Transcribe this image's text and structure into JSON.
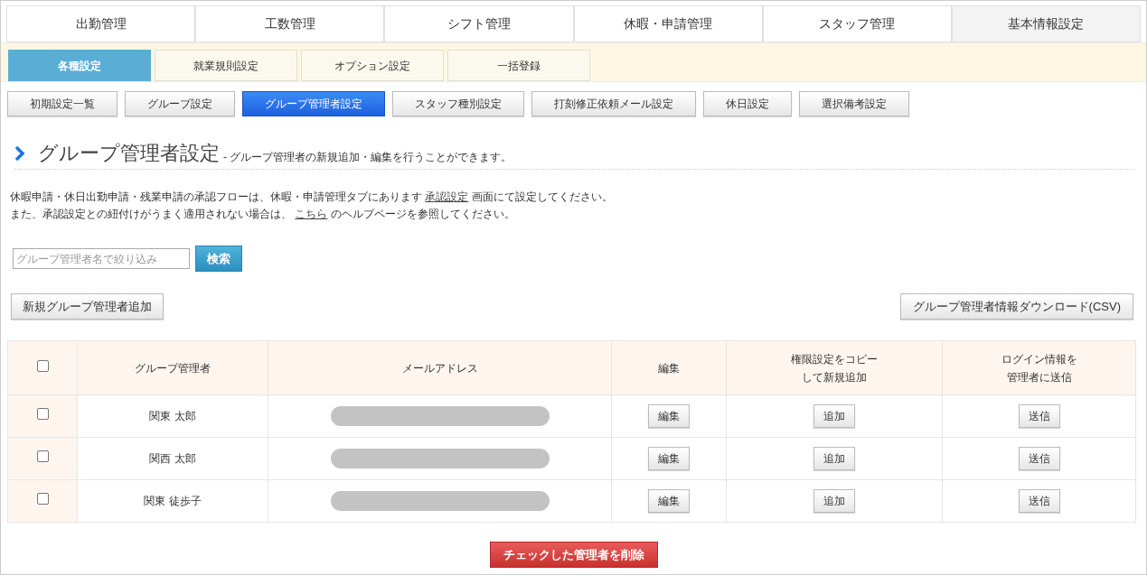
{
  "main_tabs": [
    {
      "label": "出勤管理",
      "selected": false
    },
    {
      "label": "工数管理",
      "selected": false
    },
    {
      "label": "シフト管理",
      "selected": false
    },
    {
      "label": "休暇・申請管理",
      "selected": false
    },
    {
      "label": "スタッフ管理",
      "selected": false
    },
    {
      "label": "基本情報設定",
      "selected": true
    }
  ],
  "sub_tabs": [
    {
      "label": "各種設定",
      "selected": true
    },
    {
      "label": "就業規則設定",
      "selected": false
    },
    {
      "label": "オプション設定",
      "selected": false
    },
    {
      "label": "一括登録",
      "selected": false
    }
  ],
  "setting_buttons": [
    {
      "label": "初期設定一覧",
      "selected": false
    },
    {
      "label": "グループ設定",
      "selected": false
    },
    {
      "label": "グループ管理者設定",
      "selected": true
    },
    {
      "label": "スタッフ種別設定",
      "selected": false
    },
    {
      "label": "打刻修正依頼メール設定",
      "selected": false
    },
    {
      "label": "休日設定",
      "selected": false
    },
    {
      "label": "選択備考設定",
      "selected": false
    }
  ],
  "page_title": "グループ管理者設定",
  "page_subtitle": "- グループ管理者の新規追加・編集を行うことができます。",
  "notes": [
    {
      "before": "休暇申請・休日出勤申請・残業申請の承認フローは、休暇・申請管理タブにあります ",
      "link": "承認設定",
      "after": " 画面にて設定してください。"
    },
    {
      "before": "また、承認設定との紐付けがうまく適用されない場合は、 ",
      "link": "こちら",
      "after": " のヘルプページを参照してください。"
    }
  ],
  "search": {
    "placeholder": "グループ管理者名で絞り込み",
    "button": "検索"
  },
  "add_button": "新規グループ管理者追加",
  "download_button": "グループ管理者情報ダウンロード(CSV)",
  "table": {
    "select_all_checked": false,
    "columns": [
      [
        "グループ管理者"
      ],
      [
        "メールアドレス"
      ],
      [
        "編集"
      ],
      [
        "権限設定をコピー",
        "して新規追加"
      ],
      [
        "ログイン情報を",
        "管理者に送信"
      ]
    ],
    "rows": [
      {
        "checked": false,
        "name": "関東 太郎",
        "edit": "編集",
        "copy": "追加",
        "send": "送信"
      },
      {
        "checked": false,
        "name": "関西 太郎",
        "edit": "編集",
        "copy": "追加",
        "send": "送信"
      },
      {
        "checked": false,
        "name": "関東 徒歩子",
        "edit": "編集",
        "copy": "追加",
        "send": "送信"
      }
    ]
  },
  "delete_button": "チェックした管理者を削除"
}
